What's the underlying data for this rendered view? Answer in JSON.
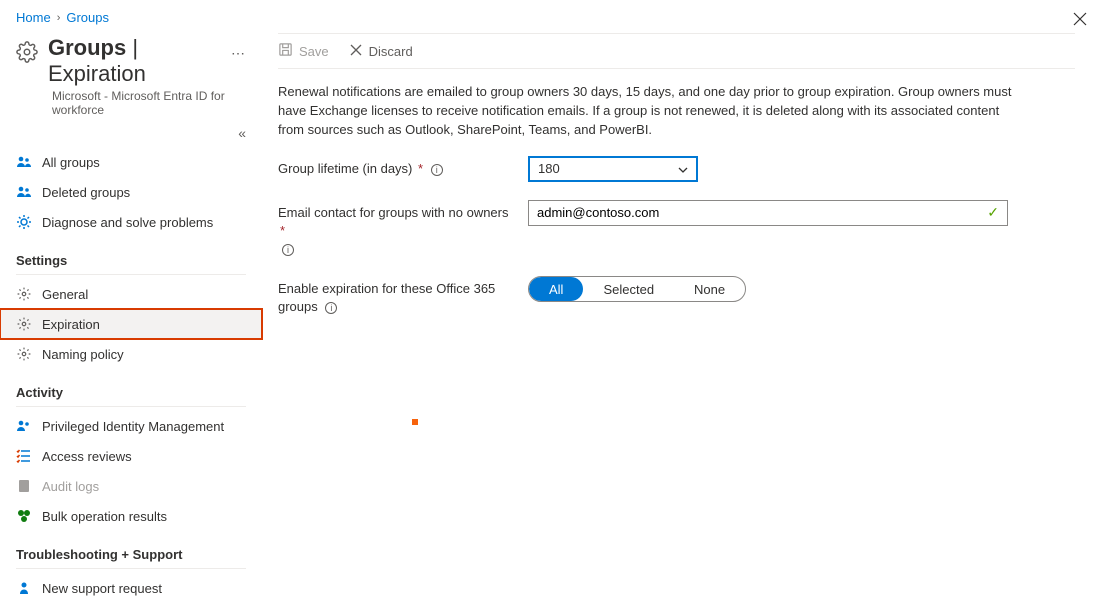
{
  "breadcrumb": {
    "home": "Home",
    "groups": "Groups"
  },
  "title": {
    "prefix": "Groups",
    "sep": " | ",
    "suffix": "Expiration"
  },
  "subtitle": "Microsoft - Microsoft Entra ID for workforce",
  "collapse_tip": "«",
  "nav": {
    "all_groups": "All groups",
    "deleted_groups": "Deleted groups",
    "diagnose": "Diagnose and solve problems"
  },
  "section_settings": "Settings",
  "settings": {
    "general": "General",
    "expiration": "Expiration",
    "naming": "Naming policy"
  },
  "section_activity": "Activity",
  "activity": {
    "pim": "Privileged Identity Management",
    "access": "Access reviews",
    "audit": "Audit logs",
    "bulk": "Bulk operation results"
  },
  "section_support": "Troubleshooting + Support",
  "support": {
    "new_req": "New support request"
  },
  "toolbar": {
    "save": "Save",
    "discard": "Discard"
  },
  "description": "Renewal notifications are emailed to group owners 30 days, 15 days, and one day prior to group expiration. Group owners must have Exchange licenses to receive notification emails. If a group is not renewed, it is deleted along with its associated content from sources such as Outlook, SharePoint, Teams, and PowerBI.",
  "form": {
    "lifetime_label": "Group lifetime (in days)",
    "lifetime_value": "180",
    "email_label": "Email contact for groups with no owners",
    "email_value": "admin@contoso.com",
    "enable_label": "Enable expiration for these Office 365 groups",
    "opt_all": "All",
    "opt_selected": "Selected",
    "opt_none": "None"
  }
}
